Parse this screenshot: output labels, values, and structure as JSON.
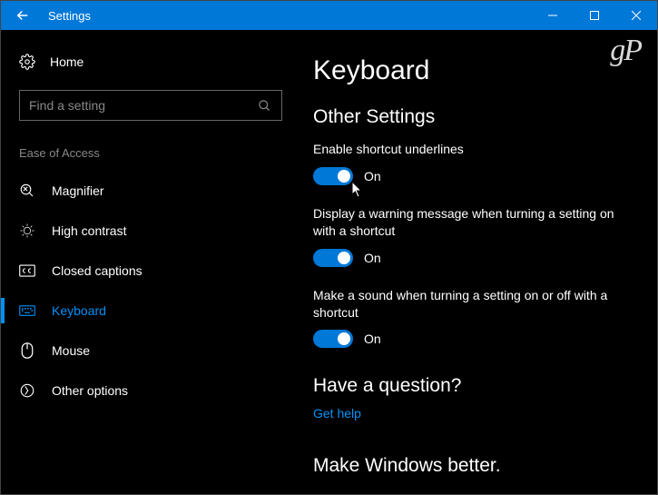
{
  "window": {
    "title": "Settings"
  },
  "sidebar": {
    "home": "Home",
    "search_placeholder": "Find a setting",
    "section": "Ease of Access",
    "items": [
      {
        "label": "Magnifier"
      },
      {
        "label": "High contrast"
      },
      {
        "label": "Closed captions"
      },
      {
        "label": "Keyboard"
      },
      {
        "label": "Mouse"
      },
      {
        "label": "Other options"
      }
    ]
  },
  "main": {
    "title": "Keyboard",
    "section_title": "Other Settings",
    "settings": [
      {
        "label": "Enable shortcut underlines",
        "state": "On"
      },
      {
        "label": "Display a warning message when turning a setting on with a shortcut",
        "state": "On"
      },
      {
        "label": "Make a sound when turning a setting on or off with a shortcut",
        "state": "On"
      }
    ],
    "question_heading": "Have a question?",
    "help_link": "Get help",
    "better_heading": "Make Windows better."
  },
  "watermark": "gP"
}
